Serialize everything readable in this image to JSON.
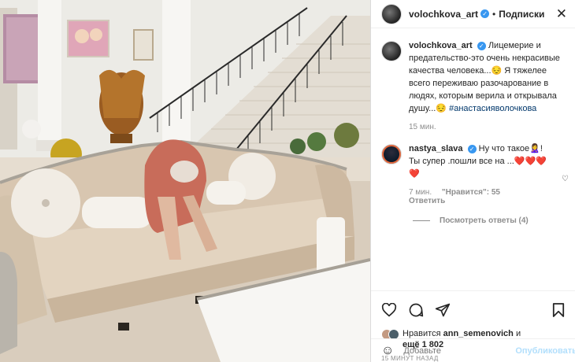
{
  "header": {
    "username": "volochkova_art",
    "separator": "•",
    "follow_label": "Подписки",
    "close_icon": "close-icon"
  },
  "caption": {
    "author": "volochkova_art",
    "text": "Лицемерие и предательство-это очень некрасивые качества человека...😔 Я тяжелее всего переживаю разочарование в людях, которым верила и открывала душу...😔",
    "hashtag": "#анастасияволочкова",
    "time": "15 мин."
  },
  "comment": {
    "author": "nastya_slava",
    "text": "Ну что такое🙎‍♀️! Ты супер .пошли все на ...❤️❤️❤️❤️",
    "time": "7 мин.",
    "likes": "\"Нравится\": 55",
    "reply_label": "Ответить",
    "view_replies": "Посмотреть ответы (4)"
  },
  "likes": {
    "prefix": "Нравится",
    "user": "ann_semenovich",
    "and": "и",
    "count": "ещё 1 802"
  },
  "post_time": "15 МИНУТ НАЗАД",
  "add_comment": {
    "placeholder": "Добавьте",
    "publish_label": "Опубликовать"
  },
  "colors": {
    "verified": "#3897f0",
    "link": "#00376b",
    "muted": "#8e8e8e",
    "publish_disabled": "#b2dffc"
  }
}
